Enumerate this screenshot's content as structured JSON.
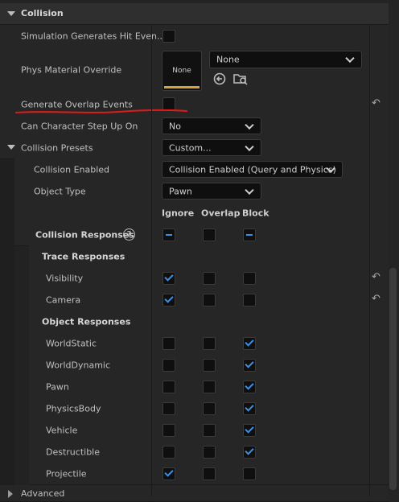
{
  "section": {
    "title": "Collision"
  },
  "rows": {
    "sim_hit": "Simulation Generates Hit Even...",
    "phys_mat": "Phys Material Override",
    "phys_mat_thumb": "None",
    "phys_mat_value": "None",
    "overlap": "Generate Overlap Events",
    "step_up": "Can Character Step Up On",
    "step_up_value": "No",
    "presets": "Collision Presets",
    "presets_value": "Custom...",
    "enabled": "Collision Enabled",
    "enabled_value": "Collision Enabled (Query and Physics)",
    "object_type": "Object Type",
    "object_type_value": "Pawn"
  },
  "columns": {
    "ignore": "Ignore",
    "overlap": "Overlap",
    "block": "Block"
  },
  "responses": {
    "title": "Collision Responses",
    "help_icon": "?",
    "trace_title": "Trace Responses",
    "object_title": "Object Responses",
    "trace": [
      {
        "label": "Visibility",
        "state": "ignore"
      },
      {
        "label": "Camera",
        "state": "ignore"
      }
    ],
    "object": [
      {
        "label": "WorldStatic",
        "state": "block"
      },
      {
        "label": "WorldDynamic",
        "state": "block"
      },
      {
        "label": "Pawn",
        "state": "block"
      },
      {
        "label": "PhysicsBody",
        "state": "block"
      },
      {
        "label": "Vehicle",
        "state": "block"
      },
      {
        "label": "Destructible",
        "state": "block"
      },
      {
        "label": "Projectile",
        "state": "ignore"
      }
    ]
  },
  "advanced": {
    "title": "Advanced"
  },
  "annotation": {
    "color": "#e01b1b"
  },
  "icons": {
    "reset": "reset-arrow-icon",
    "browse": "browse-icon",
    "use_selected": "use-selected-icon"
  }
}
